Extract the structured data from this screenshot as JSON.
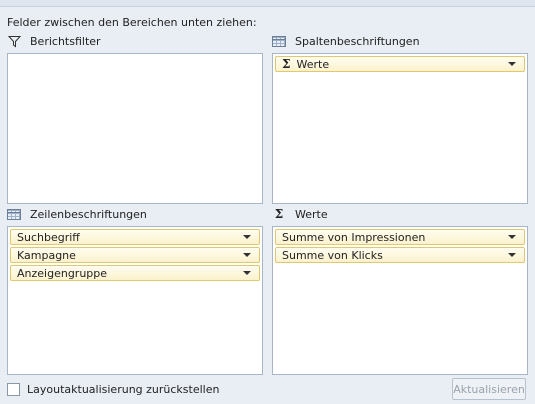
{
  "instruction": "Felder zwischen den Bereichen unten ziehen:",
  "sections": {
    "report_filter": {
      "title": "Berichtsfilter",
      "icon": "filter-icon",
      "fields": []
    },
    "column_labels": {
      "title": "Spaltenbeschriftungen",
      "icon": "column-table-icon",
      "fields": [
        "Werte"
      ]
    },
    "row_labels": {
      "title": "Zeilenbeschriftungen",
      "icon": "row-table-icon",
      "fields": [
        "Suchbegriff",
        "Kampagne",
        "Anzeigengruppe"
      ]
    },
    "values": {
      "title": "Werte",
      "icon": "sigma-icon",
      "fields": [
        "Summe von Impressionen",
        "Summe von Klicks"
      ]
    }
  },
  "footer": {
    "defer_label": "Layoutaktualisierung zurückstellen",
    "defer_checked": false,
    "update_button": "Aktualisieren"
  },
  "colors": {
    "field_border": "#e0c86e",
    "field_fill": "#fbf2cc",
    "panel_bg": "#e9eef5"
  }
}
